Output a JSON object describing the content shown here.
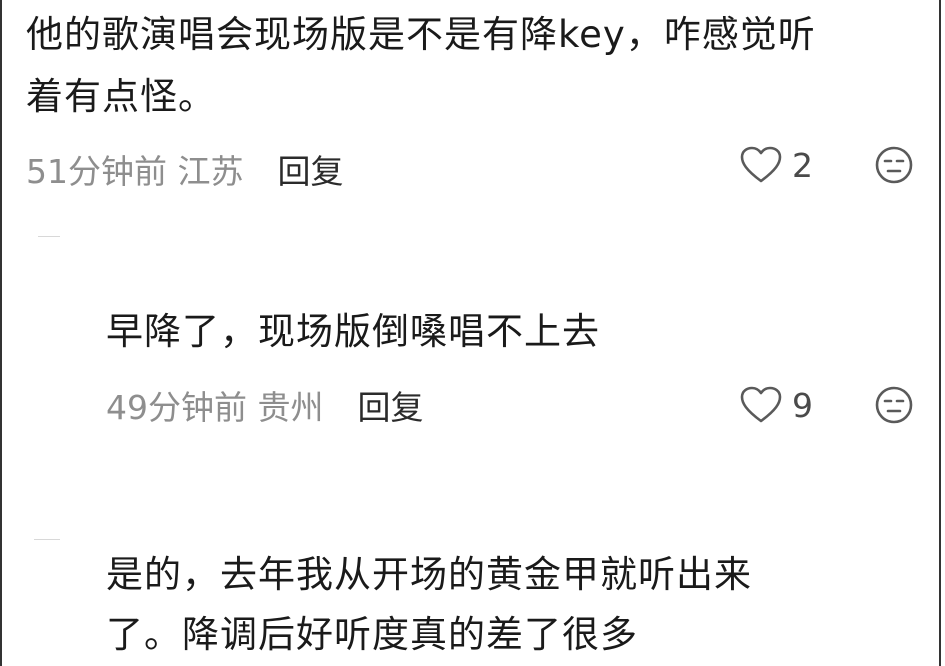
{
  "comments": [
    {
      "text_line1": "他的歌演唱会现场版是不是有降key，咋感觉听",
      "text_line2": "着有点怪。",
      "time_location": "51分钟前 江苏",
      "reply_label": "回复",
      "likes": "2",
      "like_icon": "heart-outline-icon",
      "reaction_icon": "neutral-face-icon"
    },
    {
      "text_line1": "早降了，现场版倒嗓唱不上去",
      "time_location": "49分钟前 贵州",
      "reply_label": "回复",
      "likes": "9",
      "like_icon": "heart-outline-icon",
      "reaction_icon": "neutral-face-icon"
    },
    {
      "text_line1": "是的，去年我从开场的黄金甲就听出来",
      "text_line2": "了。降调后好听度真的差了很多"
    }
  ],
  "colors": {
    "text": "#1a1a1a",
    "meta": "#8e8e8e",
    "icon": "#5a5a5a"
  }
}
